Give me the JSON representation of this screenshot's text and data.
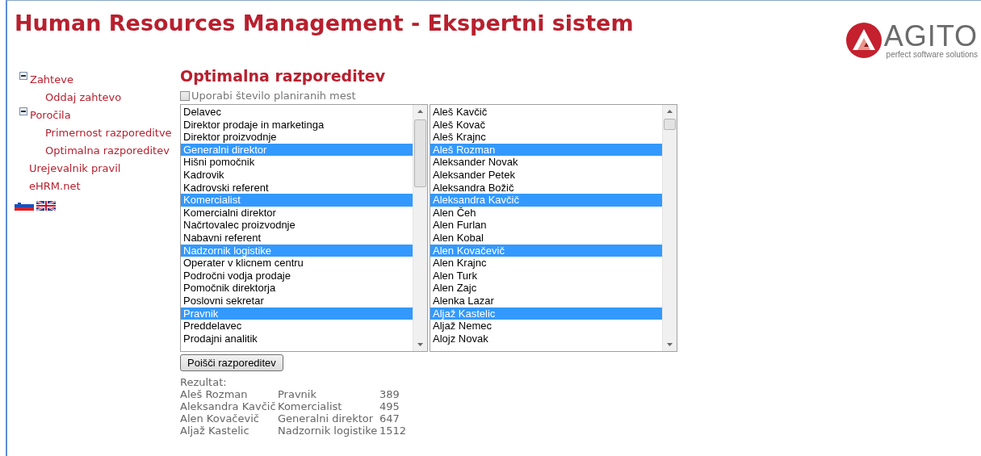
{
  "header": {
    "title": "Human Resources Management - Ekspertni sistem",
    "logo": {
      "name": "AGITO",
      "tagline": "perfect software solutions"
    }
  },
  "sidebar": {
    "items": [
      {
        "label": "Zahteve",
        "expanded": true,
        "children": [
          {
            "label": "Oddaj zahtevo"
          }
        ]
      },
      {
        "label": "Poročila",
        "expanded": true,
        "children": [
          {
            "label": "Primernost razporeditve"
          },
          {
            "label": "Optimalna razporeditev"
          }
        ]
      },
      {
        "label": "Urejevalnik pravil"
      },
      {
        "label": "eHRM.net"
      }
    ]
  },
  "main": {
    "title": "Optimalna razporeditev",
    "checkbox": {
      "label": "Uporabi število planiranih mest",
      "checked": false
    },
    "positions": [
      {
        "label": "Delavec",
        "selected": false
      },
      {
        "label": "Direktor prodaje in marketinga",
        "selected": false
      },
      {
        "label": "Direktor proizvodnje",
        "selected": false
      },
      {
        "label": "Generalni direktor",
        "selected": true
      },
      {
        "label": "Hišni pomočnik",
        "selected": false
      },
      {
        "label": "Kadrovik",
        "selected": false
      },
      {
        "label": "Kadrovski referent",
        "selected": false
      },
      {
        "label": "Komercialist",
        "selected": true
      },
      {
        "label": "Komercialni direktor",
        "selected": false
      },
      {
        "label": "Načrtovalec proizvodnje",
        "selected": false
      },
      {
        "label": "Nabavni referent",
        "selected": false
      },
      {
        "label": "Nadzornik logistike",
        "selected": true
      },
      {
        "label": "Operater v klicnem centru",
        "selected": false
      },
      {
        "label": "Področni vodja prodaje",
        "selected": false
      },
      {
        "label": "Pomočnik direktorja",
        "selected": false
      },
      {
        "label": "Poslovni sekretar",
        "selected": false
      },
      {
        "label": "Pravnik",
        "selected": true
      },
      {
        "label": "Preddelavec",
        "selected": false
      },
      {
        "label": "Prodajni analitik",
        "selected": false
      }
    ],
    "employees": [
      {
        "label": "Aleš Kavčič",
        "selected": false
      },
      {
        "label": "Aleš Kovač",
        "selected": false
      },
      {
        "label": "Aleš Krajnc",
        "selected": false
      },
      {
        "label": "Aleš Rozman",
        "selected": true
      },
      {
        "label": "Aleksander Novak",
        "selected": false
      },
      {
        "label": "Aleksander Petek",
        "selected": false
      },
      {
        "label": "Aleksandra Božič",
        "selected": false
      },
      {
        "label": "Aleksandra Kavčič",
        "selected": true
      },
      {
        "label": "Alen Čeh",
        "selected": false
      },
      {
        "label": "Alen Furlan",
        "selected": false
      },
      {
        "label": "Alen Kobal",
        "selected": false
      },
      {
        "label": "Alen Kovačevič",
        "selected": true
      },
      {
        "label": "Alen Krajnc",
        "selected": false
      },
      {
        "label": "Alen Turk",
        "selected": false
      },
      {
        "label": "Alen Zajc",
        "selected": false
      },
      {
        "label": "Alenka Lazar",
        "selected": false
      },
      {
        "label": "Aljaž Kastelic",
        "selected": true
      },
      {
        "label": "Aljaž Nemec",
        "selected": false
      },
      {
        "label": "Alojz Novak",
        "selected": false
      }
    ],
    "button": "Poišči razporeditev",
    "result_label": "Rezultat:",
    "results": [
      [
        "Aleš Rozman",
        "Pravnik",
        "389"
      ],
      [
        "Aleksandra Kavčič",
        "Komercialist",
        "495"
      ],
      [
        "Alen Kovačevič",
        "Generalni direktor",
        "647"
      ],
      [
        "Aljaž Kastelic",
        "Nadzornik logistike",
        "1512"
      ]
    ]
  }
}
